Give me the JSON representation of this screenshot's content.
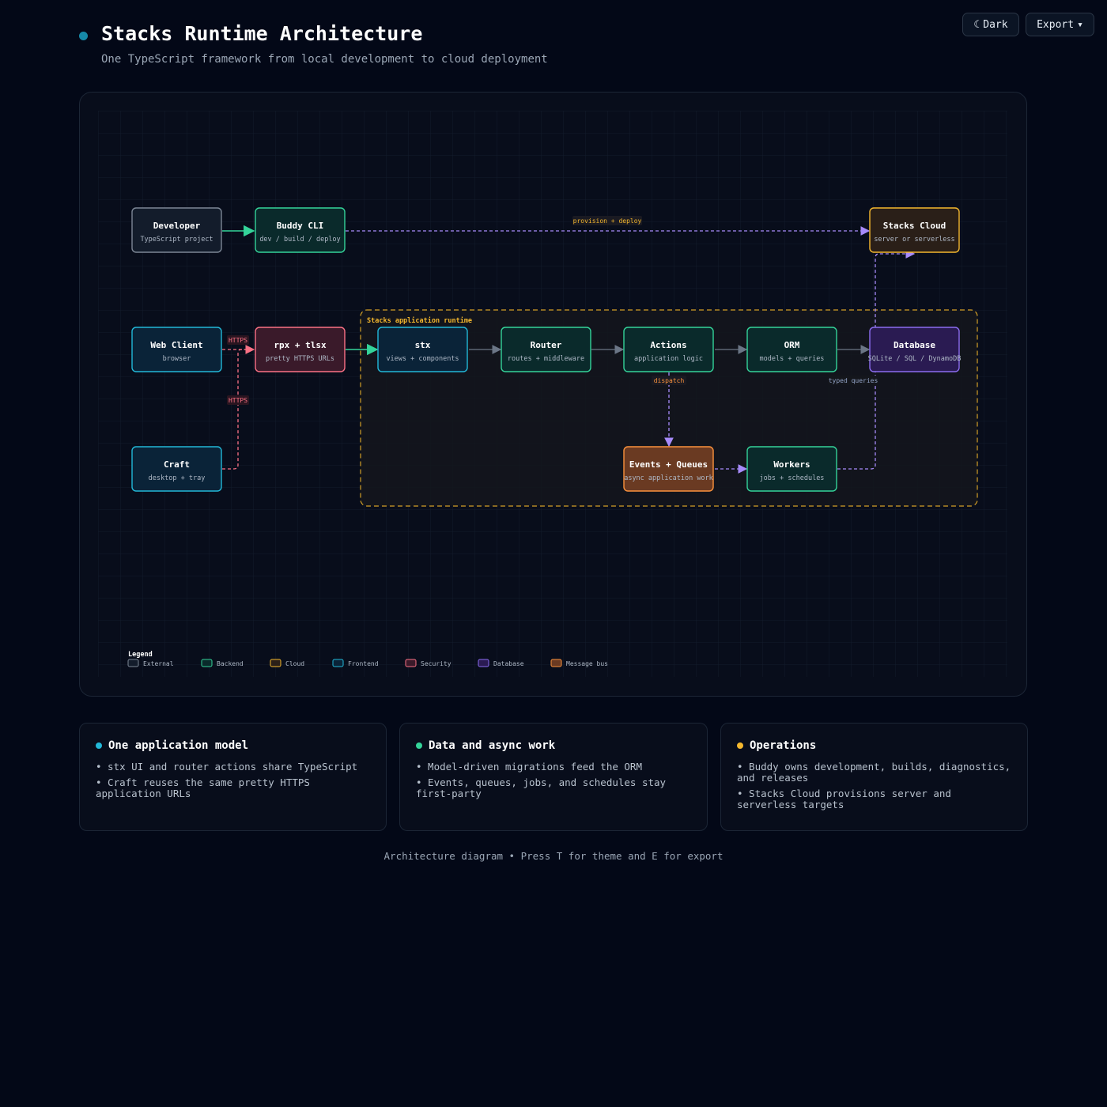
{
  "header": {
    "title": "Stacks Runtime Architecture",
    "subtitle": "One TypeScript framework from local development to cloud deployment",
    "theme_button": {
      "icon": "moon-icon",
      "label": "Dark"
    },
    "export_button": {
      "label": "Export",
      "icon": "chevron-down-icon"
    }
  },
  "diagram": {
    "group": {
      "label": "Stacks application runtime",
      "color": "#f5b82e"
    },
    "nodes": [
      {
        "id": "developer",
        "title": "Developer",
        "subtitle": "TypeScript project",
        "category": "external"
      },
      {
        "id": "buddy",
        "title": "Buddy CLI",
        "subtitle": "dev / build / deploy",
        "category": "backend"
      },
      {
        "id": "cloud",
        "title": "Stacks Cloud",
        "subtitle": "server or serverless",
        "category": "cloud"
      },
      {
        "id": "webclient",
        "title": "Web Client",
        "subtitle": "browser",
        "category": "frontend"
      },
      {
        "id": "rpx",
        "title": "rpx + tlsx",
        "subtitle": "pretty HTTPS URLs",
        "category": "security"
      },
      {
        "id": "stx",
        "title": "stx",
        "subtitle": "views + components",
        "category": "frontend"
      },
      {
        "id": "router",
        "title": "Router",
        "subtitle": "routes + middleware",
        "category": "backend"
      },
      {
        "id": "actions",
        "title": "Actions",
        "subtitle": "application logic",
        "category": "backend"
      },
      {
        "id": "orm",
        "title": "ORM",
        "subtitle": "models + queries",
        "category": "backend"
      },
      {
        "id": "database",
        "title": "Database",
        "subtitle": "SQLite / SQL / DynamoDB",
        "category": "database"
      },
      {
        "id": "craft",
        "title": "Craft",
        "subtitle": "desktop + tray",
        "category": "frontend"
      },
      {
        "id": "events",
        "title": "Events + Queues",
        "subtitle": "async application work",
        "category": "message_bus"
      },
      {
        "id": "workers",
        "title": "Workers",
        "subtitle": "jobs + schedules",
        "category": "backend"
      }
    ],
    "edges": [
      {
        "from": "developer",
        "to": "buddy",
        "label": "",
        "style": "solid",
        "color": "#34d399"
      },
      {
        "from": "buddy",
        "to": "cloud",
        "label": "provision + deploy",
        "style": "dashed",
        "color": "#a78bfa",
        "label_color": "#f5b82e"
      },
      {
        "from": "webclient",
        "to": "rpx",
        "label": "HTTPS",
        "style": "dashed",
        "color": "#fb7185",
        "label_color": "#fb7185"
      },
      {
        "from": "craft",
        "to": "rpx",
        "label": "HTTPS",
        "style": "dashed",
        "color": "#fb7185",
        "label_color": "#fb7185"
      },
      {
        "from": "rpx",
        "to": "stx",
        "label": "",
        "style": "solid",
        "color": "#34d399"
      },
      {
        "from": "stx",
        "to": "router",
        "label": "",
        "style": "solid",
        "color": "#6b7686"
      },
      {
        "from": "router",
        "to": "actions",
        "label": "",
        "style": "solid",
        "color": "#6b7686"
      },
      {
        "from": "actions",
        "to": "orm",
        "label": "",
        "style": "solid",
        "color": "#6b7686"
      },
      {
        "from": "orm",
        "to": "database",
        "label": "",
        "style": "solid",
        "color": "#6b7686"
      },
      {
        "from": "actions",
        "to": "events",
        "label": "dispatch",
        "style": "dashed",
        "color": "#a78bfa",
        "label_color": "#fb923c"
      },
      {
        "from": "events",
        "to": "workers",
        "label": "",
        "style": "dashed",
        "color": "#a78bfa"
      },
      {
        "from": "workers",
        "to": "cloud",
        "label": "typed queries",
        "style": "dashed",
        "color": "#a78bfa",
        "label_color": "#93a4c8"
      }
    ],
    "categories": {
      "external": {
        "stroke": "#7d8796",
        "fill": "#131c2b"
      },
      "backend": {
        "stroke": "#34d399",
        "fill": "#0a2a2b"
      },
      "cloud": {
        "stroke": "#f5b82e",
        "fill": "#2a1f18"
      },
      "frontend": {
        "stroke": "#22b8d8",
        "fill": "#0a2338"
      },
      "security": {
        "stroke": "#fb7185",
        "fill": "#3a1a2a"
      },
      "database": {
        "stroke": "#8b6cf0",
        "fill": "#2a1b52"
      },
      "message_bus": {
        "stroke": "#fb923c",
        "fill": "#6a3a22"
      }
    },
    "legend": {
      "title": "Legend",
      "items": [
        {
          "key": "external",
          "label": "External"
        },
        {
          "key": "backend",
          "label": "Backend"
        },
        {
          "key": "cloud",
          "label": "Cloud"
        },
        {
          "key": "frontend",
          "label": "Frontend"
        },
        {
          "key": "security",
          "label": "Security"
        },
        {
          "key": "database",
          "label": "Database"
        },
        {
          "key": "message_bus",
          "label": "Message bus"
        }
      ]
    }
  },
  "cards": [
    {
      "title": "One application model",
      "dot_color": "#22b8d8",
      "items": [
        "• stx UI and router actions share TypeScript",
        "• Craft reuses the same pretty HTTPS application URLs"
      ]
    },
    {
      "title": "Data and async work",
      "dot_color": "#34d399",
      "items": [
        "• Model-driven migrations feed the ORM",
        "• Events, queues, jobs, and schedules stay first-party"
      ]
    },
    {
      "title": "Operations",
      "dot_color": "#f5b82e",
      "items": [
        "• Buddy owns development, builds, diagnostics, and releases",
        "• Stacks Cloud provisions server and serverless targets"
      ]
    }
  ],
  "footer": "Architecture diagram • Press T for theme and E for export"
}
